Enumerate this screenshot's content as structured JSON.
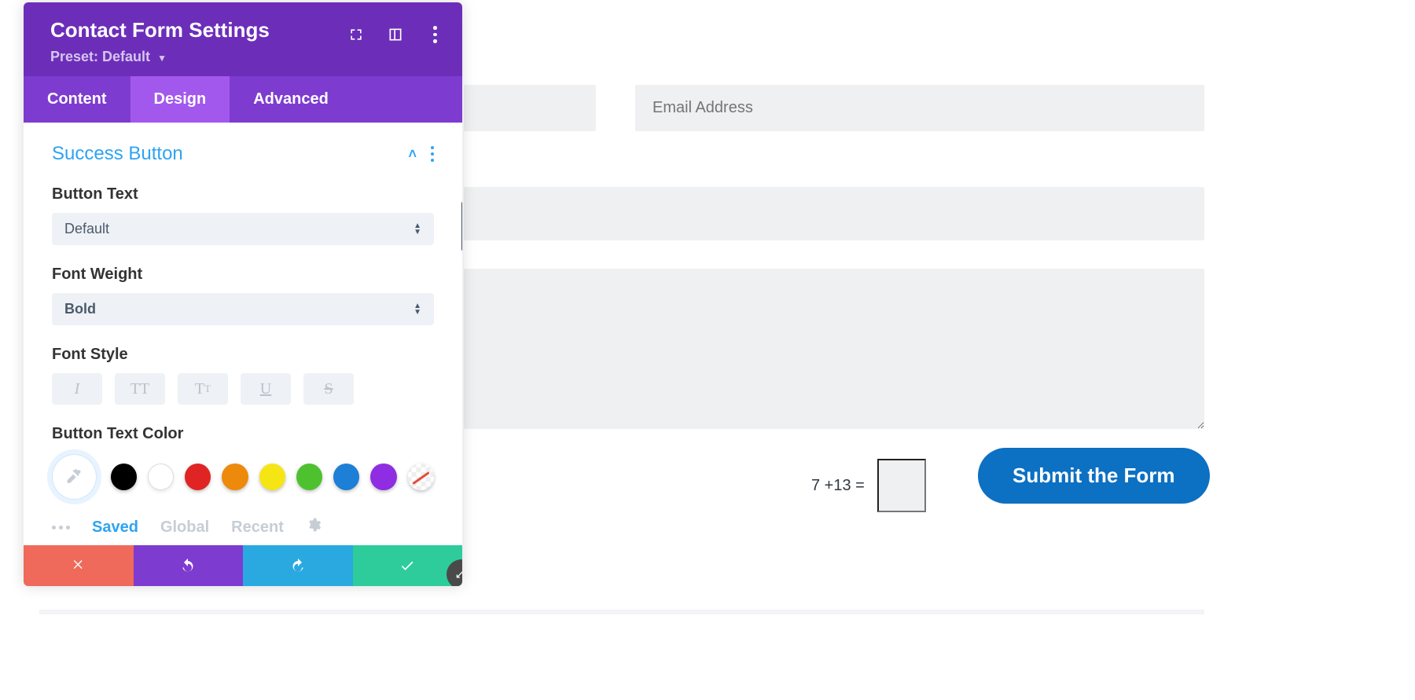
{
  "panel": {
    "title": "Contact Form Settings",
    "preset_label": "Preset:",
    "preset_value": "Default",
    "tabs": [
      "Content",
      "Design",
      "Advanced"
    ],
    "active_tab": "Design"
  },
  "section": {
    "title": "Success Button"
  },
  "fields": {
    "button_text": {
      "label": "Button Text",
      "value": "Default"
    },
    "font_weight": {
      "label": "Font Weight",
      "value": "Bold"
    },
    "font_style": {
      "label": "Font Style"
    },
    "button_text_color": {
      "label": "Button Text Color"
    }
  },
  "font_style_options": {
    "italic": "I",
    "uppercase_big": "T",
    "uppercase_small": "T",
    "smallcaps_big": "T",
    "smallcaps_small": "T",
    "underline": "U",
    "strike": "S"
  },
  "swatches": [
    "#000000",
    "#ffffff",
    "#e02424",
    "#ed8a0c",
    "#f6e514",
    "#4dc22e",
    "#1d7fd6",
    "#8e2de2"
  ],
  "palette_tabs": {
    "saved": "Saved",
    "global": "Global",
    "recent": "Recent",
    "active": "Saved"
  },
  "form": {
    "email_placeholder": "Email Address",
    "captcha": "7 +13 =",
    "submit_label": "Submit the Form"
  }
}
